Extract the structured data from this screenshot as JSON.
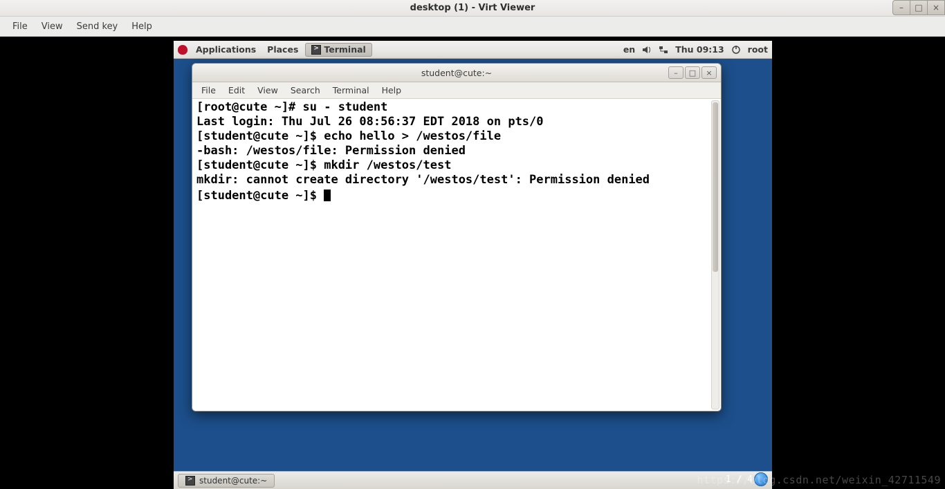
{
  "host": {
    "title": "desktop (1) - Virt Viewer",
    "menu": {
      "file": "File",
      "view": "View",
      "sendkey": "Send key",
      "help": "Help"
    },
    "controls": {
      "min": "–",
      "max": "□",
      "close": "×"
    }
  },
  "vm": {
    "panel": {
      "applications": "Applications",
      "places": "Places",
      "active_app": "Terminal",
      "lang": "en",
      "time": "Thu 09:13",
      "user": "root"
    },
    "bottom_task": "student@cute:~"
  },
  "terminal": {
    "title": "student@cute:~",
    "menu": {
      "file": "File",
      "edit": "Edit",
      "view": "View",
      "search": "Search",
      "terminal": "Terminal",
      "help": "Help"
    },
    "controls": {
      "min": "–",
      "max": "□",
      "close": "×"
    },
    "lines": [
      "[root@cute ~]# su - student",
      "Last login: Thu Jul 26 08:56:37 EDT 2018 on pts/0",
      "[student@cute ~]$ echo hello > /westos/file",
      "-bash: /westos/file: Permission denied",
      "[student@cute ~]$ mkdir /westos/test",
      "mkdir: cannot create directory '/westos/test': Permission denied",
      "[student@cute ~]$ "
    ]
  },
  "overlay": {
    "page": "1 / 4",
    "watermark": "https://blog.csdn.net/weixin_42711549"
  }
}
